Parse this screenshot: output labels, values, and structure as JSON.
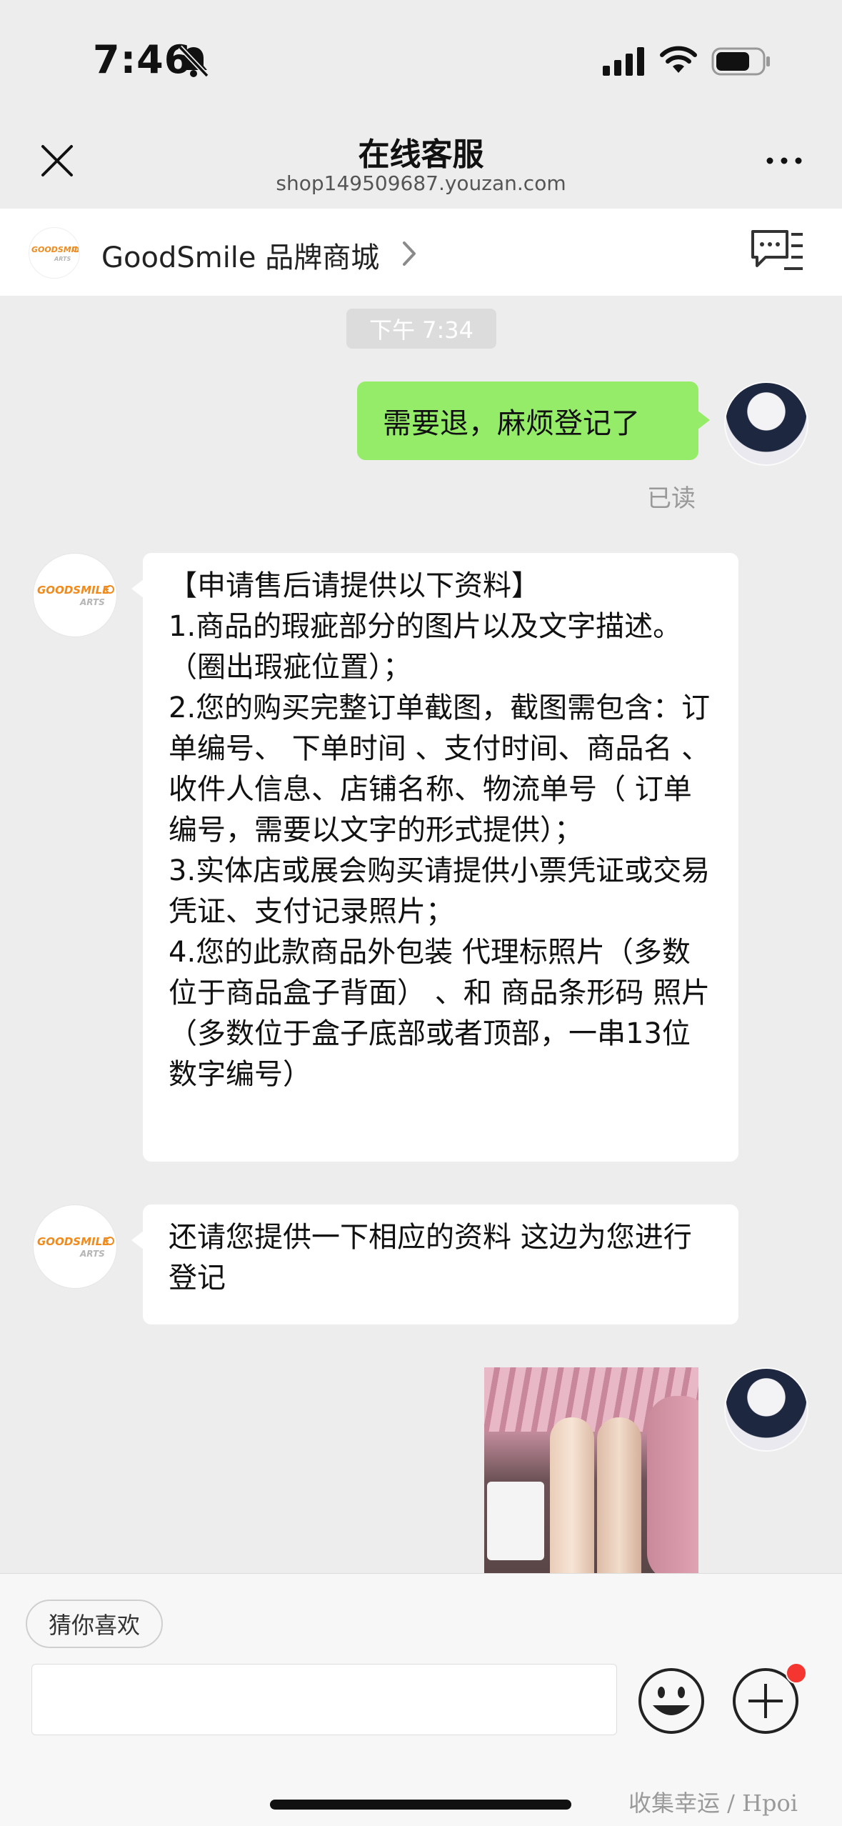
{
  "status_bar": {
    "time": "7:46",
    "icons": [
      "bell-off-icon",
      "cellular-signal-icon",
      "wifi-icon",
      "battery-icon"
    ]
  },
  "nav": {
    "title": "在线客服",
    "subtitle": "shop149509687.youzan.com",
    "icons": [
      "close-icon",
      "more-icon"
    ]
  },
  "shop": {
    "logo_text": "GOODSMILE ARTS",
    "name": "GoodSmile 品牌商城",
    "icons": [
      "chevron-right-icon",
      "chat-list-icon"
    ]
  },
  "chat": {
    "timestamp": "下午 7:34",
    "messages": [
      {
        "from": "me",
        "type": "text",
        "text": "需要退，麻烦登记了"
      },
      {
        "from": "me",
        "type": "status",
        "text": "已读"
      },
      {
        "from": "shop",
        "type": "text",
        "text": "【申请售后请提供以下资料】\n1.商品的瑕疵部分的图片以及文字描述。（圈出瑕疵位置）；\n2.您的购买完整订单截图，截图需包含：订单编号、 下单时间 、支付时间、商品名 、收件人信息、店铺名称、物流单号（ 订单编号，需要以文字的形式提供）；\n3.实体店或展会购买请提供小票凭证或交易凭证、支付记录照片；\n4.您的此款商品外包装 代理标照片（多数位于商品盒子背面） 、和 商品条形码 照片（多数位于盒子底部或者顶部，一串13位数字编号）"
      },
      {
        "from": "shop",
        "type": "text",
        "text": "还请您提供一下相应的资料 这边为您进行登记"
      },
      {
        "from": "me",
        "type": "image"
      }
    ]
  },
  "input_bar": {
    "suggestion_chip": "猜你喜欢",
    "input_value": "",
    "icons": [
      "emoji-icon",
      "plus-icon"
    ],
    "badge_color": "#f43530"
  },
  "watermark": "收集幸运 / Hpoi",
  "colors": {
    "my_bubble": "#95ec69",
    "shop_bubble": "#ffffff",
    "background": "#ededed"
  }
}
